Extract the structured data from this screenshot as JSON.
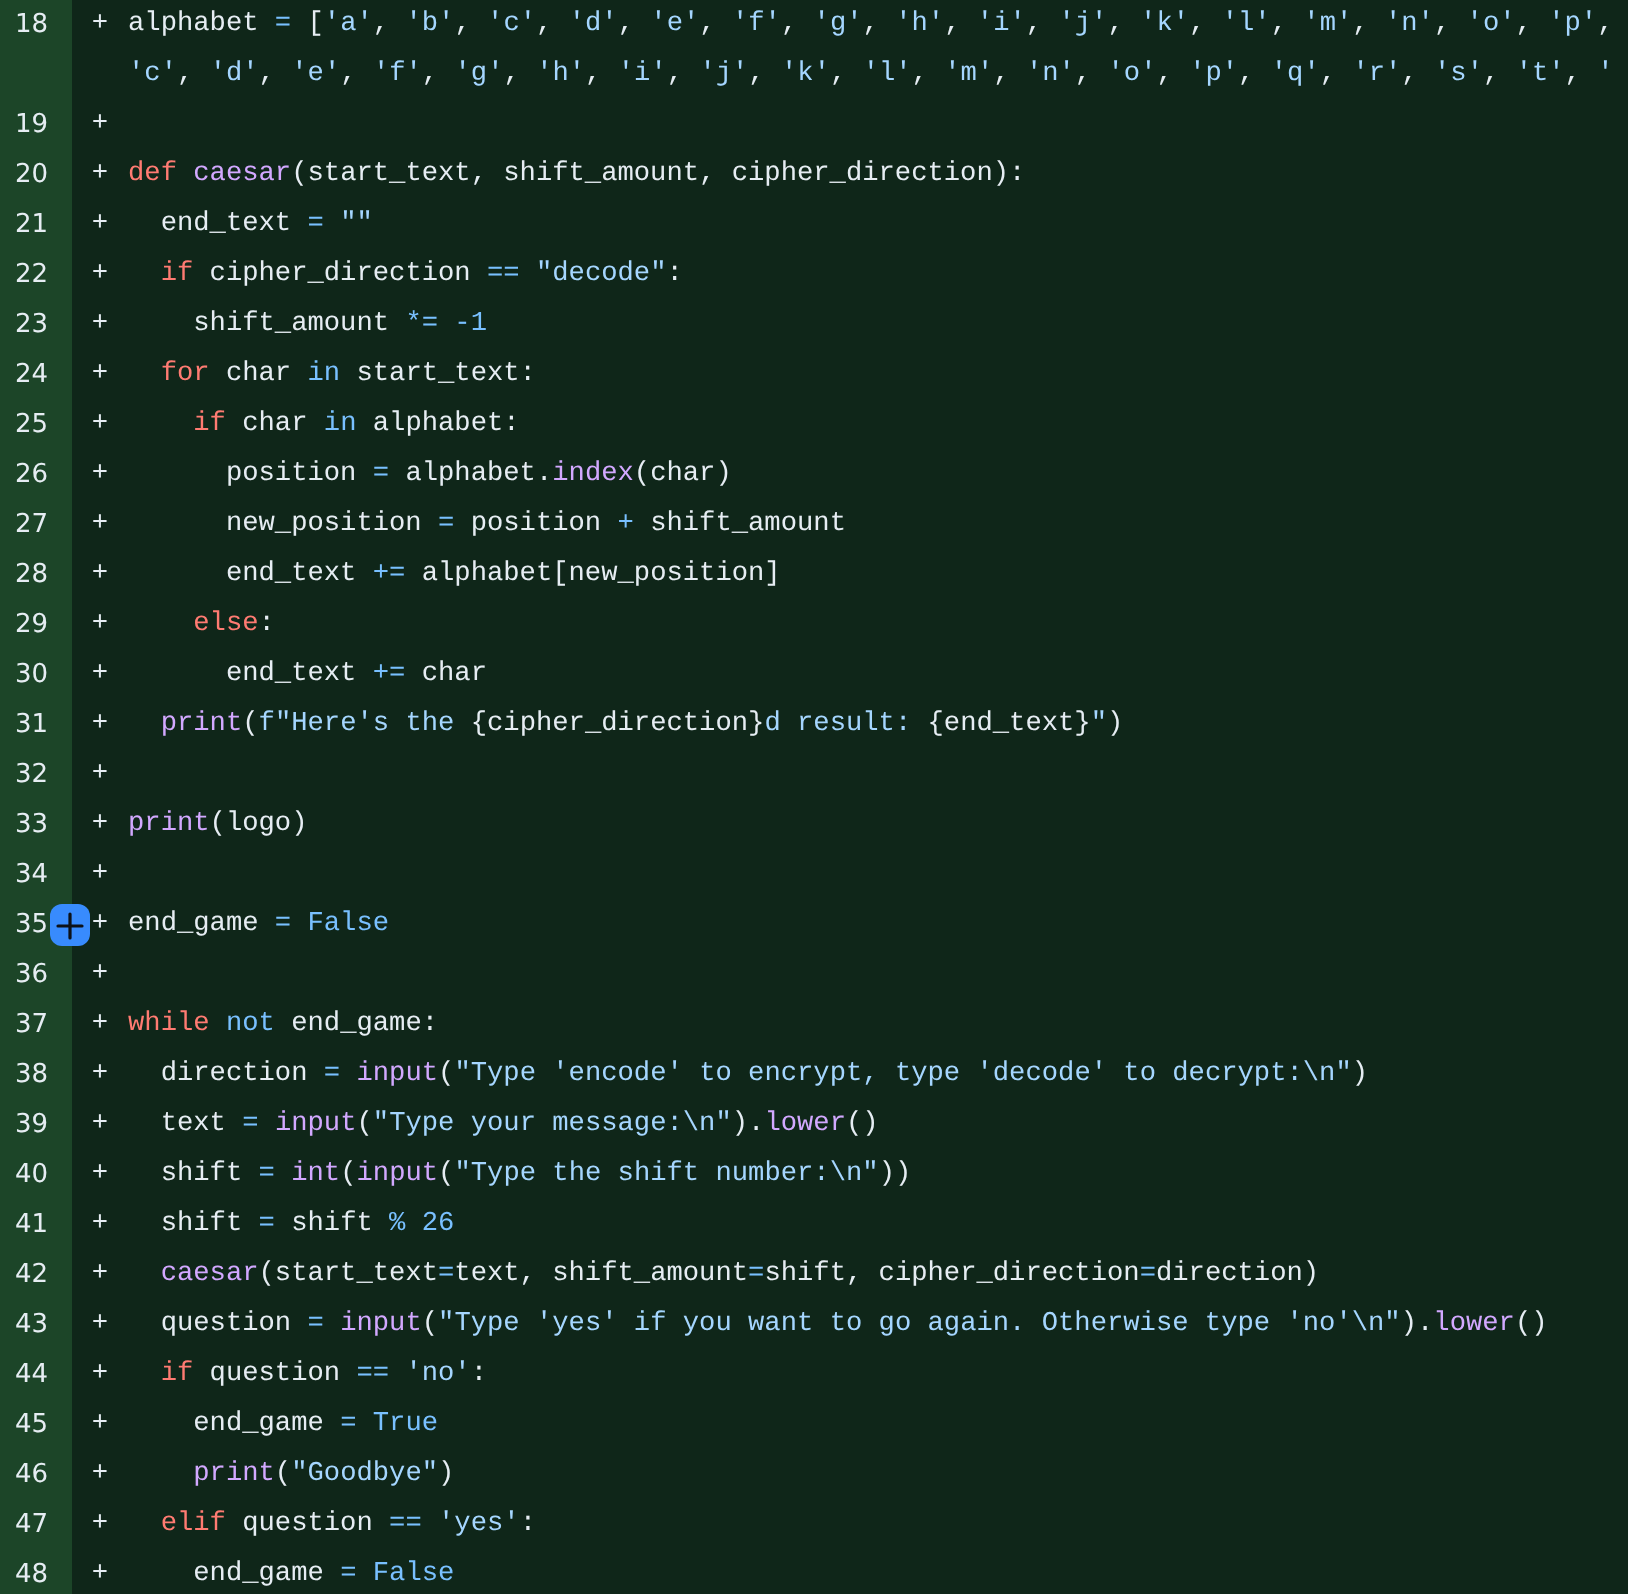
{
  "diff": {
    "lines": [
      {
        "number": "18",
        "sign": "+",
        "hovered": false,
        "tokens": [
          {
            "text": "alphabet ",
            "kind": "plain"
          },
          {
            "text": "= ",
            "kind": "op"
          },
          {
            "text": "[",
            "kind": "plain"
          },
          {
            "text": "'a'",
            "kind": "str"
          },
          {
            "text": ", ",
            "kind": "plain"
          },
          {
            "text": "'b'",
            "kind": "str"
          },
          {
            "text": ", ",
            "kind": "plain"
          },
          {
            "text": "'c'",
            "kind": "str"
          },
          {
            "text": ", ",
            "kind": "plain"
          },
          {
            "text": "'d'",
            "kind": "str"
          },
          {
            "text": ", ",
            "kind": "plain"
          },
          {
            "text": "'e'",
            "kind": "str"
          },
          {
            "text": ", ",
            "kind": "plain"
          },
          {
            "text": "'f'",
            "kind": "str"
          },
          {
            "text": ", ",
            "kind": "plain"
          },
          {
            "text": "'g'",
            "kind": "str"
          },
          {
            "text": ", ",
            "kind": "plain"
          },
          {
            "text": "'h'",
            "kind": "str"
          },
          {
            "text": ", ",
            "kind": "plain"
          },
          {
            "text": "'i'",
            "kind": "str"
          },
          {
            "text": ", ",
            "kind": "plain"
          },
          {
            "text": "'j'",
            "kind": "str"
          },
          {
            "text": ", ",
            "kind": "plain"
          },
          {
            "text": "'k'",
            "kind": "str"
          },
          {
            "text": ", ",
            "kind": "plain"
          },
          {
            "text": "'l'",
            "kind": "str"
          },
          {
            "text": ", ",
            "kind": "plain"
          },
          {
            "text": "'m'",
            "kind": "str"
          },
          {
            "text": ", ",
            "kind": "plain"
          },
          {
            "text": "'n'",
            "kind": "str"
          },
          {
            "text": ", ",
            "kind": "plain"
          },
          {
            "text": "'o'",
            "kind": "str"
          },
          {
            "text": ", ",
            "kind": "plain"
          },
          {
            "text": "'p'",
            "kind": "str"
          },
          {
            "text": ",",
            "kind": "plain"
          }
        ],
        "wrap_tokens": [
          {
            "text": "'c'",
            "kind": "str"
          },
          {
            "text": ", ",
            "kind": "plain"
          },
          {
            "text": "'d'",
            "kind": "str"
          },
          {
            "text": ", ",
            "kind": "plain"
          },
          {
            "text": "'e'",
            "kind": "str"
          },
          {
            "text": ", ",
            "kind": "plain"
          },
          {
            "text": "'f'",
            "kind": "str"
          },
          {
            "text": ", ",
            "kind": "plain"
          },
          {
            "text": "'g'",
            "kind": "str"
          },
          {
            "text": ", ",
            "kind": "plain"
          },
          {
            "text": "'h'",
            "kind": "str"
          },
          {
            "text": ", ",
            "kind": "plain"
          },
          {
            "text": "'i'",
            "kind": "str"
          },
          {
            "text": ", ",
            "kind": "plain"
          },
          {
            "text": "'j'",
            "kind": "str"
          },
          {
            "text": ", ",
            "kind": "plain"
          },
          {
            "text": "'k'",
            "kind": "str"
          },
          {
            "text": ", ",
            "kind": "plain"
          },
          {
            "text": "'l'",
            "kind": "str"
          },
          {
            "text": ", ",
            "kind": "plain"
          },
          {
            "text": "'m'",
            "kind": "str"
          },
          {
            "text": ", ",
            "kind": "plain"
          },
          {
            "text": "'n'",
            "kind": "str"
          },
          {
            "text": ", ",
            "kind": "plain"
          },
          {
            "text": "'o'",
            "kind": "str"
          },
          {
            "text": ", ",
            "kind": "plain"
          },
          {
            "text": "'p'",
            "kind": "str"
          },
          {
            "text": ", ",
            "kind": "plain"
          },
          {
            "text": "'q'",
            "kind": "str"
          },
          {
            "text": ", ",
            "kind": "plain"
          },
          {
            "text": "'r'",
            "kind": "str"
          },
          {
            "text": ", ",
            "kind": "plain"
          },
          {
            "text": "'s'",
            "kind": "str"
          },
          {
            "text": ", ",
            "kind": "plain"
          },
          {
            "text": "'t'",
            "kind": "str"
          },
          {
            "text": ", ",
            "kind": "plain"
          },
          {
            "text": "'",
            "kind": "str"
          }
        ]
      },
      {
        "number": "19",
        "sign": "+",
        "hovered": false
      },
      {
        "number": "20",
        "sign": "+",
        "hovered": false,
        "tokens": [
          {
            "text": "def ",
            "kind": "kw"
          },
          {
            "text": "caesar",
            "kind": "fn"
          },
          {
            "text": "(start_text, shift_amount, cipher_direction):",
            "kind": "plain"
          }
        ]
      },
      {
        "number": "21",
        "sign": "+",
        "hovered": false,
        "tokens": [
          {
            "text": "  end_text ",
            "kind": "plain"
          },
          {
            "text": "= ",
            "kind": "op"
          },
          {
            "text": "\"\"",
            "kind": "str"
          }
        ]
      },
      {
        "number": "22",
        "sign": "+",
        "hovered": false,
        "tokens": [
          {
            "text": "  if",
            "kind": "kw"
          },
          {
            "text": " cipher_direction ",
            "kind": "plain"
          },
          {
            "text": "== ",
            "kind": "op"
          },
          {
            "text": "\"decode\"",
            "kind": "str"
          },
          {
            "text": ":",
            "kind": "plain"
          }
        ]
      },
      {
        "number": "23",
        "sign": "+",
        "hovered": false,
        "tokens": [
          {
            "text": "    shift_amount ",
            "kind": "plain"
          },
          {
            "text": "*= -1",
            "kind": "op"
          }
        ]
      },
      {
        "number": "24",
        "sign": "+",
        "hovered": false,
        "tokens": [
          {
            "text": "  for",
            "kind": "kw"
          },
          {
            "text": " char ",
            "kind": "plain"
          },
          {
            "text": "in",
            "kind": "op"
          },
          {
            "text": " start_text:",
            "kind": "plain"
          }
        ]
      },
      {
        "number": "25",
        "sign": "+",
        "hovered": false,
        "tokens": [
          {
            "text": "    if",
            "kind": "kw"
          },
          {
            "text": " char ",
            "kind": "plain"
          },
          {
            "text": "in",
            "kind": "op"
          },
          {
            "text": " alphabet:",
            "kind": "plain"
          }
        ]
      },
      {
        "number": "26",
        "sign": "+",
        "hovered": false,
        "tokens": [
          {
            "text": "      position ",
            "kind": "plain"
          },
          {
            "text": "=",
            "kind": "op"
          },
          {
            "text": " alphabet.",
            "kind": "plain"
          },
          {
            "text": "index",
            "kind": "fn"
          },
          {
            "text": "(char)",
            "kind": "plain"
          }
        ]
      },
      {
        "number": "27",
        "sign": "+",
        "hovered": false,
        "tokens": [
          {
            "text": "      new_position ",
            "kind": "plain"
          },
          {
            "text": "=",
            "kind": "op"
          },
          {
            "text": " position ",
            "kind": "plain"
          },
          {
            "text": "+",
            "kind": "op"
          },
          {
            "text": " shift_amount",
            "kind": "plain"
          }
        ]
      },
      {
        "number": "28",
        "sign": "+",
        "hovered": false,
        "tokens": [
          {
            "text": "      end_text ",
            "kind": "plain"
          },
          {
            "text": "+=",
            "kind": "op"
          },
          {
            "text": " alphabet[new_position]",
            "kind": "plain"
          }
        ]
      },
      {
        "number": "29",
        "sign": "+",
        "hovered": false,
        "tokens": [
          {
            "text": "    else",
            "kind": "kw"
          },
          {
            "text": ":",
            "kind": "plain"
          }
        ]
      },
      {
        "number": "30",
        "sign": "+",
        "hovered": false,
        "tokens": [
          {
            "text": "      end_text ",
            "kind": "plain"
          },
          {
            "text": "+=",
            "kind": "op"
          },
          {
            "text": " char",
            "kind": "plain"
          }
        ]
      },
      {
        "number": "31",
        "sign": "+",
        "hovered": false,
        "tokens": [
          {
            "text": "  print",
            "kind": "fn"
          },
          {
            "text": "(",
            "kind": "plain"
          },
          {
            "text": "f\"Here's the ",
            "kind": "str"
          },
          {
            "text": "{cipher_direction}",
            "kind": "plain"
          },
          {
            "text": "d result: ",
            "kind": "str"
          },
          {
            "text": "{end_text}",
            "kind": "plain"
          },
          {
            "text": "\"",
            "kind": "str"
          },
          {
            "text": ")",
            "kind": "plain"
          }
        ]
      },
      {
        "number": "32",
        "sign": "+",
        "hovered": false
      },
      {
        "number": "33",
        "sign": "+",
        "hovered": false,
        "tokens": [
          {
            "text": "print",
            "kind": "fn"
          },
          {
            "text": "(logo)",
            "kind": "plain"
          }
        ]
      },
      {
        "number": "34",
        "sign": "+",
        "hovered": false
      },
      {
        "number": "35",
        "sign": "+",
        "hovered": true,
        "tokens": [
          {
            "text": "end_game ",
            "kind": "plain"
          },
          {
            "text": "= False",
            "kind": "op"
          }
        ]
      },
      {
        "number": "36",
        "sign": "+",
        "hovered": false
      },
      {
        "number": "37",
        "sign": "+",
        "hovered": false,
        "tokens": [
          {
            "text": "while ",
            "kind": "kw"
          },
          {
            "text": "not",
            "kind": "op"
          },
          {
            "text": " end_game:",
            "kind": "plain"
          }
        ]
      },
      {
        "number": "38",
        "sign": "+",
        "hovered": false,
        "tokens": [
          {
            "text": "  direction ",
            "kind": "plain"
          },
          {
            "text": "= ",
            "kind": "op"
          },
          {
            "text": "input",
            "kind": "fn"
          },
          {
            "text": "(",
            "kind": "plain"
          },
          {
            "text": "\"Type 'encode' to encrypt, type 'decode' to decrypt:\\n\"",
            "kind": "str"
          },
          {
            "text": ")",
            "kind": "plain"
          }
        ]
      },
      {
        "number": "39",
        "sign": "+",
        "hovered": false,
        "tokens": [
          {
            "text": "  text ",
            "kind": "plain"
          },
          {
            "text": "= ",
            "kind": "op"
          },
          {
            "text": "input",
            "kind": "fn"
          },
          {
            "text": "(",
            "kind": "plain"
          },
          {
            "text": "\"Type your message:\\n\"",
            "kind": "str"
          },
          {
            "text": ").",
            "kind": "plain"
          },
          {
            "text": "lower",
            "kind": "fn"
          },
          {
            "text": "()",
            "kind": "plain"
          }
        ]
      },
      {
        "number": "40",
        "sign": "+",
        "hovered": false,
        "tokens": [
          {
            "text": "  shift ",
            "kind": "plain"
          },
          {
            "text": "= ",
            "kind": "op"
          },
          {
            "text": "int",
            "kind": "fn"
          },
          {
            "text": "(",
            "kind": "plain"
          },
          {
            "text": "input",
            "kind": "fn"
          },
          {
            "text": "(",
            "kind": "plain"
          },
          {
            "text": "\"Type the shift number:\\n\"",
            "kind": "str"
          },
          {
            "text": "))",
            "kind": "plain"
          }
        ]
      },
      {
        "number": "41",
        "sign": "+",
        "hovered": false,
        "tokens": [
          {
            "text": "  shift ",
            "kind": "plain"
          },
          {
            "text": "=",
            "kind": "op"
          },
          {
            "text": " shift ",
            "kind": "plain"
          },
          {
            "text": "% 26",
            "kind": "op"
          }
        ]
      },
      {
        "number": "42",
        "sign": "+",
        "hovered": false,
        "tokens": [
          {
            "text": "  caesar",
            "kind": "fn"
          },
          {
            "text": "(start_text",
            "kind": "plain"
          },
          {
            "text": "=",
            "kind": "op"
          },
          {
            "text": "text, shift_amount",
            "kind": "plain"
          },
          {
            "text": "=",
            "kind": "op"
          },
          {
            "text": "shift, cipher_direction",
            "kind": "plain"
          },
          {
            "text": "=",
            "kind": "op"
          },
          {
            "text": "direction)",
            "kind": "plain"
          }
        ]
      },
      {
        "number": "43",
        "sign": "+",
        "hovered": false,
        "tokens": [
          {
            "text": "  question ",
            "kind": "plain"
          },
          {
            "text": "= ",
            "kind": "op"
          },
          {
            "text": "input",
            "kind": "fn"
          },
          {
            "text": "(",
            "kind": "plain"
          },
          {
            "text": "\"Type 'yes' if you want to go again. Otherwise type 'no'\\n\"",
            "kind": "str"
          },
          {
            "text": ").",
            "kind": "plain"
          },
          {
            "text": "lower",
            "kind": "fn"
          },
          {
            "text": "()",
            "kind": "plain"
          }
        ]
      },
      {
        "number": "44",
        "sign": "+",
        "hovered": false,
        "tokens": [
          {
            "text": "  if",
            "kind": "kw"
          },
          {
            "text": " question ",
            "kind": "plain"
          },
          {
            "text": "== ",
            "kind": "op"
          },
          {
            "text": "'no'",
            "kind": "str"
          },
          {
            "text": ":",
            "kind": "plain"
          }
        ]
      },
      {
        "number": "45",
        "sign": "+",
        "hovered": false,
        "tokens": [
          {
            "text": "    end_game ",
            "kind": "plain"
          },
          {
            "text": "= True",
            "kind": "op"
          }
        ]
      },
      {
        "number": "46",
        "sign": "+",
        "hovered": false,
        "tokens": [
          {
            "text": "    print",
            "kind": "fn"
          },
          {
            "text": "(",
            "kind": "plain"
          },
          {
            "text": "\"Goodbye\"",
            "kind": "str"
          },
          {
            "text": ")",
            "kind": "plain"
          }
        ]
      },
      {
        "number": "47",
        "sign": "+",
        "hovered": false,
        "tokens": [
          {
            "text": "  elif",
            "kind": "kw"
          },
          {
            "text": " question ",
            "kind": "plain"
          },
          {
            "text": "== ",
            "kind": "op"
          },
          {
            "text": "'yes'",
            "kind": "str"
          },
          {
            "text": ":",
            "kind": "plain"
          }
        ]
      },
      {
        "number": "48",
        "sign": "+",
        "hovered": false,
        "tokens": [
          {
            "text": "    end_game ",
            "kind": "plain"
          },
          {
            "text": "= False",
            "kind": "op"
          }
        ]
      }
    ]
  }
}
